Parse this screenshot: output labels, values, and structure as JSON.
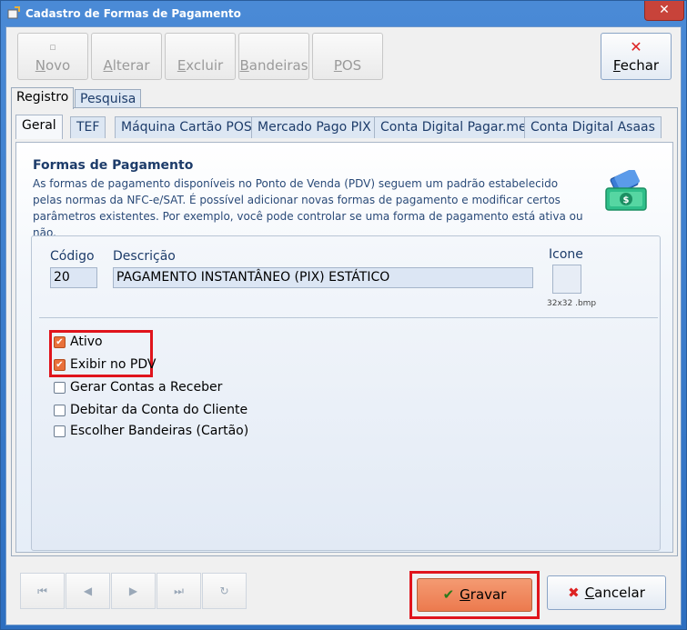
{
  "window": {
    "title": "Cadastro de Formas de Pagamento",
    "close_glyph": "✕"
  },
  "toolbar": {
    "buttons": [
      {
        "label": "Novo",
        "underline": "N",
        "icon": "new-icon",
        "enabled": false
      },
      {
        "label": "Alterar",
        "underline": "A",
        "icon": "edit-icon",
        "enabled": false
      },
      {
        "label": "Excluir",
        "underline": "E",
        "icon": "delete-icon",
        "enabled": false
      },
      {
        "label": "Bandeiras",
        "underline": "B",
        "icon": "flags-icon",
        "enabled": false
      },
      {
        "label": "POS",
        "underline": "P",
        "icon": "pos-icon",
        "enabled": false
      }
    ],
    "fechar": {
      "label": "Fechar",
      "underline": "F",
      "icon": "close-icon"
    }
  },
  "outer_tabs": [
    "Registro",
    "Pesquisa"
  ],
  "inner_tabs": [
    "Geral",
    "TEF",
    "Máquina Cartão POS",
    "Mercado Pago PIX",
    "Conta Digital Pagar.me",
    "Conta Digital Asaas"
  ],
  "info": {
    "title": "Formas de Pagamento",
    "text": "As formas de pagamento disponíveis no Ponto de Venda (PDV) seguem um padrão estabelecido pelas normas da NFC-e/SAT. É possível adicionar novas formas de pagamento e modificar certos parâmetros existentes. Por exemplo, você pode controlar se uma forma de pagamento está ativa ou não."
  },
  "form": {
    "codigo_label": "Código",
    "codigo_value": "20",
    "descricao_label": "Descrição",
    "descricao_value": "PAGAMENTO INSTANTÂNEO (PIX) ESTÁTICO",
    "icone_label": "Icone",
    "icone_hint": "32x32 .bmp",
    "checkboxes": [
      {
        "label": "Ativo",
        "checked": true
      },
      {
        "label": "Exibir no PDV",
        "checked": true
      },
      {
        "label": "Gerar Contas a Receber",
        "checked": false
      },
      {
        "label": "Debitar da Conta do Cliente",
        "checked": false
      },
      {
        "label": "Escolher Bandeiras (Cartão)",
        "checked": false
      }
    ]
  },
  "footer": {
    "nav": [
      "first-icon",
      "prev-icon",
      "next-icon",
      "last-icon",
      "refresh-icon"
    ],
    "gravar": {
      "label": "Gravar",
      "underline": "G"
    },
    "cancelar": {
      "label": "Cancelar",
      "underline": "C"
    }
  },
  "colors": {
    "accent": "#2e6fc0",
    "primary_action": "#ec7a4e",
    "highlight": "#e0141c"
  }
}
